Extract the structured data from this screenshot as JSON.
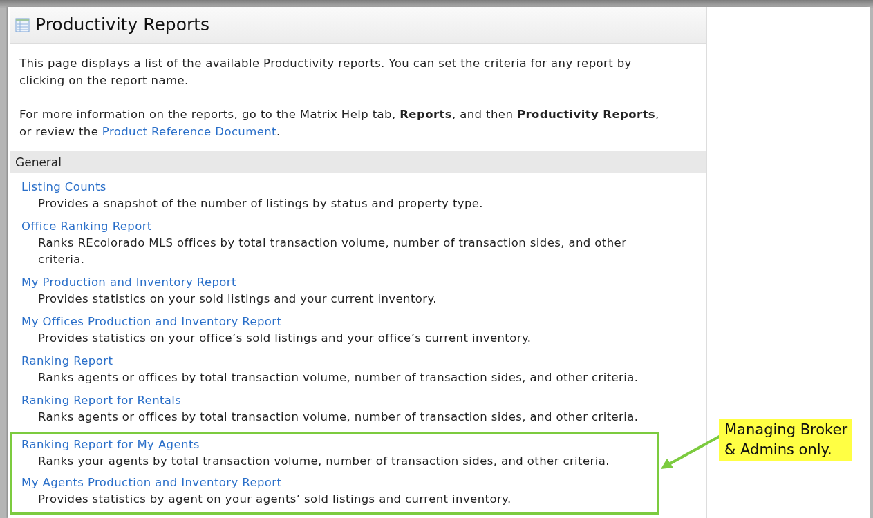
{
  "header": {
    "title": "Productivity Reports"
  },
  "intro": [
    {
      "parts": [
        {
          "kind": "text",
          "text": "This page displays a list of the available Productivity reports. You can set the criteria for any report by clicking on the report name."
        }
      ]
    },
    {
      "parts": [
        {
          "kind": "text",
          "text": "For more information on the reports, go to the Matrix Help tab, **Reports**, and then **Productivity Reports**, or review the "
        },
        {
          "kind": "link",
          "text": "Product Reference Document"
        },
        {
          "kind": "text",
          "text": "."
        }
      ]
    }
  ],
  "section": {
    "title": "General"
  },
  "reports": [
    {
      "name": "Listing Counts",
      "description": "Provides a snapshot of the number of listings by status and property type.",
      "highlighted": false
    },
    {
      "name": "Office Ranking Report",
      "description": "Ranks REcolorado MLS offices by total transaction volume, number of transaction sides, and other criteria.",
      "highlighted": false
    },
    {
      "name": "My Production and Inventory Report",
      "description": "Provides statistics on your sold listings and your current inventory.",
      "highlighted": false
    },
    {
      "name": "My Offices Production and Inventory Report",
      "description": "Provides statistics on your office’s sold listings and your office’s current inventory.",
      "highlighted": false
    },
    {
      "name": "Ranking Report",
      "description": "Ranks agents or offices by total transaction volume, number of transaction sides, and other criteria.",
      "highlighted": false
    },
    {
      "name": "Ranking Report for Rentals",
      "description": "Ranks agents or offices by total transaction volume, number of transaction sides, and other criteria.",
      "highlighted": false
    },
    {
      "name": "Ranking Report for My Agents",
      "description": "Ranks your agents by total transaction volume, number of transaction sides, and other criteria.",
      "highlighted": true
    },
    {
      "name": "My Agents Production and Inventory Report",
      "description": "Provides statistics by agent on your agents’ sold listings and current inventory.",
      "highlighted": true
    }
  ],
  "callout": {
    "lines": [
      "Managing Broker",
      "& Admins only."
    ]
  }
}
